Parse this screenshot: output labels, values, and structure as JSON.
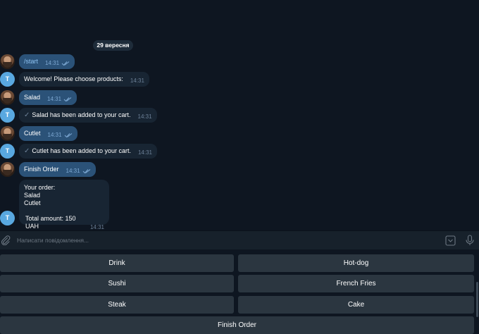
{
  "chat": {
    "date": "29 вересня",
    "messages": [
      {
        "text": "/start",
        "time": "14:31"
      },
      {
        "text": "Welcome! Please choose products:",
        "time": "14:31"
      },
      {
        "text": "Salad",
        "time": "14:31"
      },
      {
        "text": "Salad has been added to your cart.",
        "time": "14:31"
      },
      {
        "text": "Cutlet",
        "time": "14:31"
      },
      {
        "text": "Cutlet has been added to your cart.",
        "time": "14:31"
      },
      {
        "text": "Finish Order",
        "time": "14:31"
      }
    ],
    "bot_avatar_letter": "T",
    "order_summary": {
      "header": "Your order:",
      "items": [
        "Salad",
        "Cutlet"
      ],
      "total": "Total amount: 150 UAH",
      "time": "14:31"
    }
  },
  "input": {
    "placeholder": "Написати повідомлення..."
  },
  "keyboard": {
    "buttons": [
      "Drink",
      "Hot-dog",
      "Sushi",
      "French Fries",
      "Steak",
      "Cake",
      "Finish Order"
    ]
  },
  "colors": {
    "background": "#0e1621",
    "outgoing_bubble": "#2b5278",
    "incoming_bubble": "#182533",
    "keyboard_button": "#2b3640",
    "bot_avatar": "#59a8e0"
  }
}
